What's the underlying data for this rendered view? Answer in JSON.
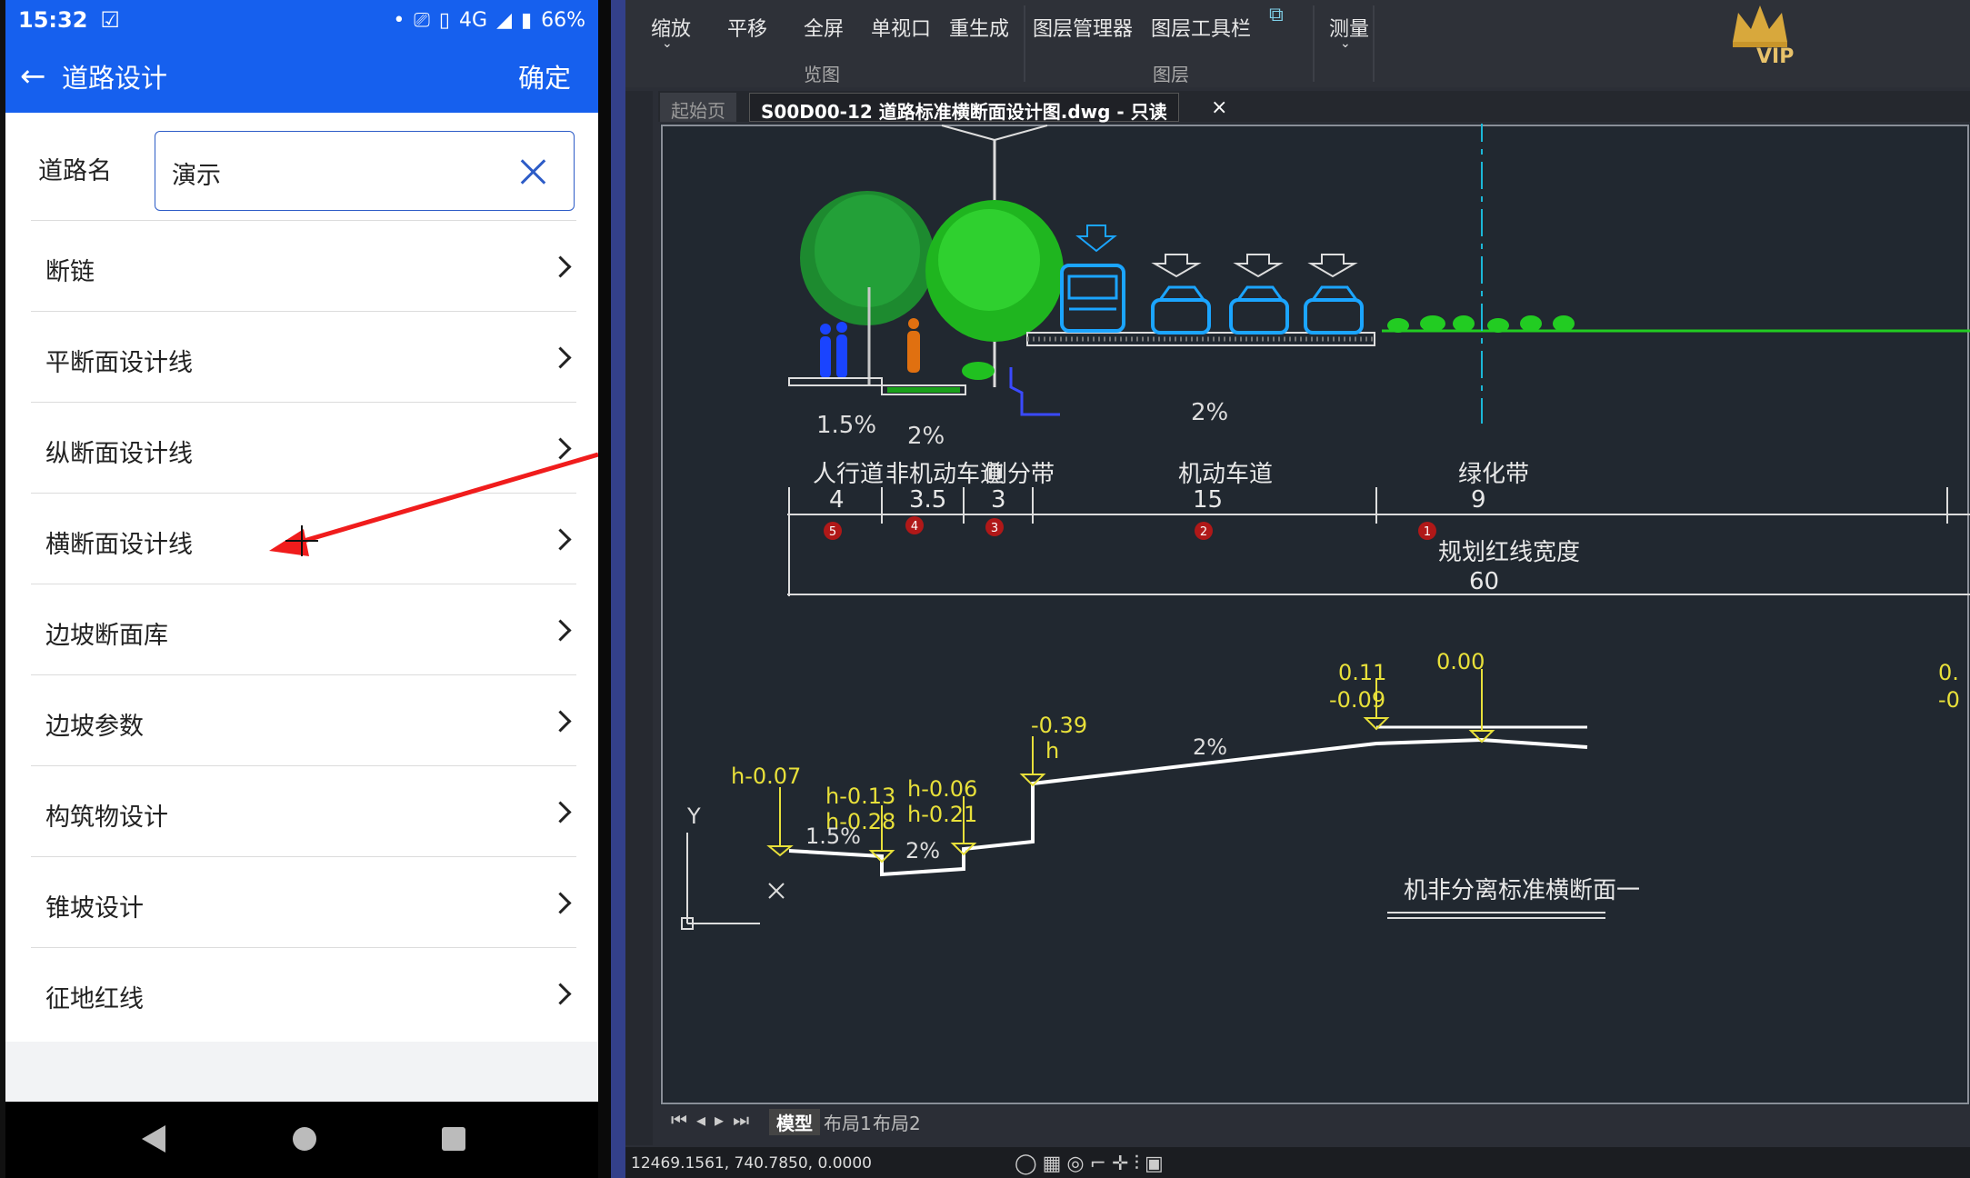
{
  "phone": {
    "status_bar": {
      "time": "15:32",
      "network": "4G",
      "battery": "66%"
    },
    "header": {
      "back_icon": "arrow-left-icon",
      "title": "道路设计",
      "confirm": "确定"
    },
    "road_name": {
      "label": "道路名",
      "value": "演示"
    },
    "menu_items": [
      {
        "label": "断链"
      },
      {
        "label": "平断面设计线"
      },
      {
        "label": "纵断面设计线"
      },
      {
        "label": "横断面设计线"
      },
      {
        "label": "边坡断面库"
      },
      {
        "label": "边坡参数"
      },
      {
        "label": "构筑物设计"
      },
      {
        "label": "锥坡设计"
      },
      {
        "label": "征地红线"
      }
    ]
  },
  "cad": {
    "ribbon": {
      "buttons": [
        "缩放",
        "平移",
        "全屏",
        "单视口",
        "重生成",
        "图层管理器",
        "图层工具栏",
        "测量"
      ],
      "groups": [
        "览图",
        "图层"
      ],
      "vip": "VIP"
    },
    "tabs": {
      "start": "起始页",
      "document": "S00D00-12 道路标准横断面设计图.dwg - 只读"
    },
    "drawing": {
      "segments": [
        {
          "name": "人行道",
          "width": "4",
          "badge": "5"
        },
        {
          "name": "非机动车道",
          "width": "3.5",
          "badge": "4"
        },
        {
          "name": "侧分带",
          "width": "3",
          "badge": "3"
        },
        {
          "name": "机动车道",
          "width": "15",
          "badge": "2"
        },
        {
          "name": "绿化带",
          "width": "9",
          "badge": "1"
        }
      ],
      "total_label": "规划红线宽度",
      "total_value": "60",
      "top_slopes": [
        "1.5%",
        "2%",
        "2%"
      ],
      "bottom_slopes": [
        "1.5%",
        "2%",
        "2%"
      ],
      "elevations": [
        "h-0.07",
        "h-0.13",
        "h-0.28",
        "h-0.06",
        "h-0.21",
        "-0.39",
        "h",
        "0.11",
        "-0.09",
        "0.00",
        "0.",
        "-0"
      ],
      "axis_y": "Y",
      "caption": "机非分离标准横断面一"
    },
    "layout_tabs": [
      "模型",
      "布局1",
      "布局2"
    ],
    "coords": "12469.1561, 740.7850, 0.0000"
  }
}
